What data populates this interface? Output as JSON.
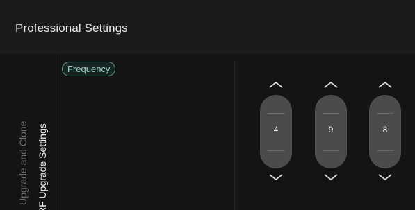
{
  "header": {
    "title": "Professional Settings"
  },
  "nav": {
    "tabs": [
      {
        "label": "Upgrade and Clone",
        "active": false
      },
      {
        "label": "RF Upgrade Settings",
        "active": true
      }
    ]
  },
  "main": {
    "selected_item": "Frequency"
  },
  "picker": {
    "digits": [
      "4",
      "9",
      "8"
    ],
    "up_icon": "chevron-up-icon",
    "down_icon": "chevron-down-icon"
  },
  "colors": {
    "background": "#141414",
    "header_background": "#1b1b1b",
    "chip_border": "#6f9f94",
    "chip_text": "#9fd3c6",
    "picker_pill": "#4b4b4b"
  }
}
